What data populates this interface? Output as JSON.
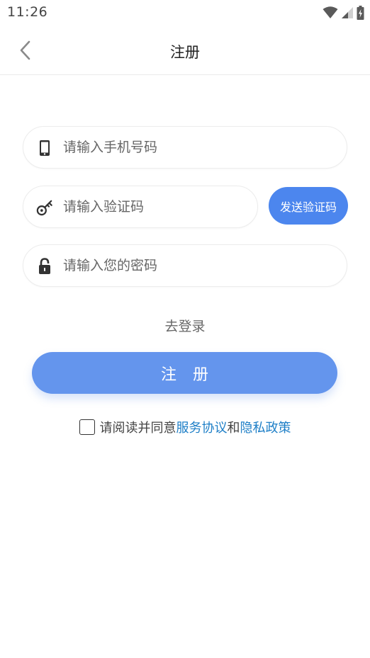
{
  "status_bar": {
    "time": "11:26",
    "icons": [
      "wifi-icon",
      "signal-icon",
      "battery-charging-icon"
    ]
  },
  "header": {
    "title": "注册",
    "back_icon": "chevron-left-icon"
  },
  "form": {
    "phone": {
      "placeholder": "请输入手机号码",
      "value": "",
      "icon": "phone-icon"
    },
    "code": {
      "placeholder": "请输入验证码",
      "value": "",
      "icon": "key-icon"
    },
    "send_code_label": "发送验证码",
    "password": {
      "placeholder": "请输入您的密码",
      "value": "",
      "icon": "lock-icon"
    }
  },
  "login_link": "去登录",
  "register_label": "注 册",
  "agreement": {
    "prefix": "请阅读并同意",
    "service_link": "服务协议",
    "and": "和",
    "privacy_link": "隐私政策",
    "checked": false
  },
  "colors": {
    "accent": "#4c86ee",
    "register_button": "#6495ed",
    "link": "#1e7fc7"
  }
}
